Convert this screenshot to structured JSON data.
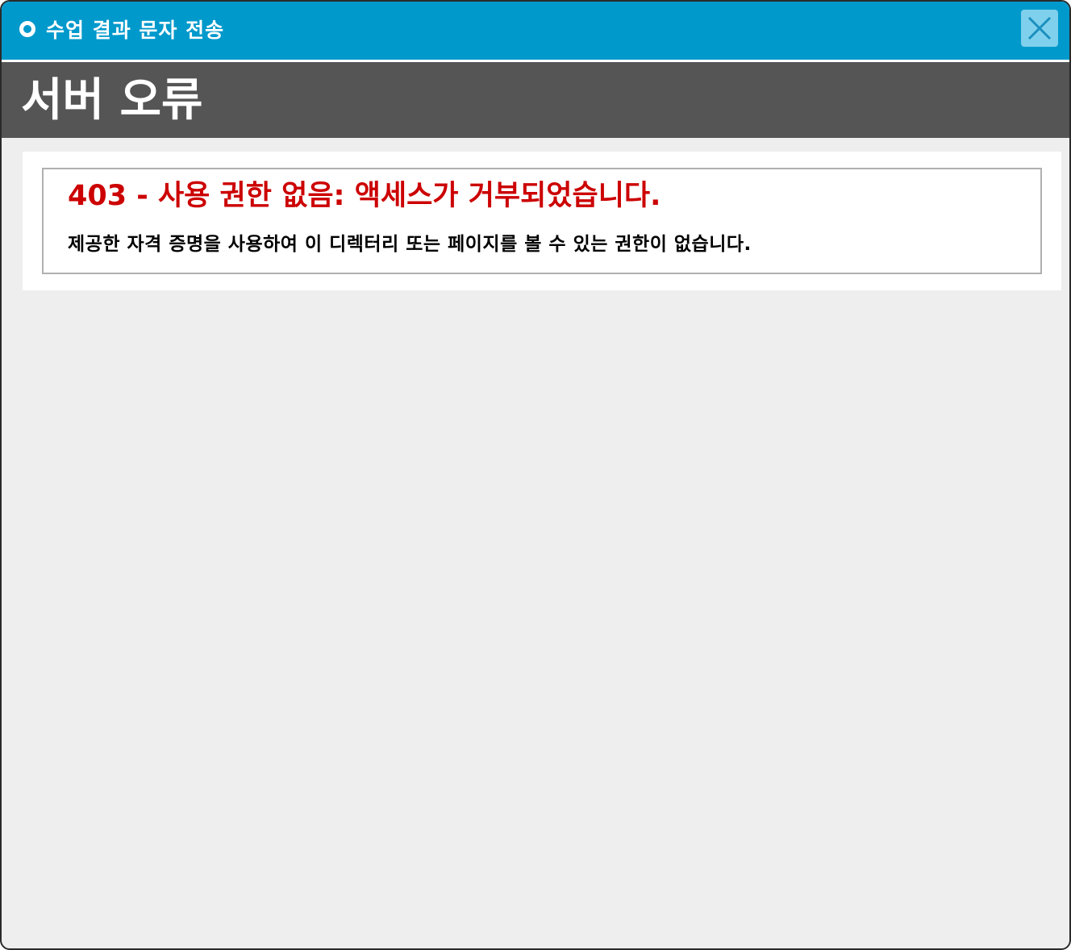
{
  "window": {
    "title": "수업 결과 문자 전송",
    "close_icon": "close-icon"
  },
  "header": {
    "title": "서버 오류"
  },
  "error": {
    "title": "403 - 사용 권한 없음: 액세스가 거부되었습니다.",
    "detail": "제공한 자격 증명을 사용하여 이 디렉터리 또는 페이지를 볼 수 있는 권한이 없습니다."
  },
  "colors": {
    "titlebar": "#0099cc",
    "header": "#555555",
    "error_title": "#cc0000",
    "background": "#eeeeee"
  }
}
